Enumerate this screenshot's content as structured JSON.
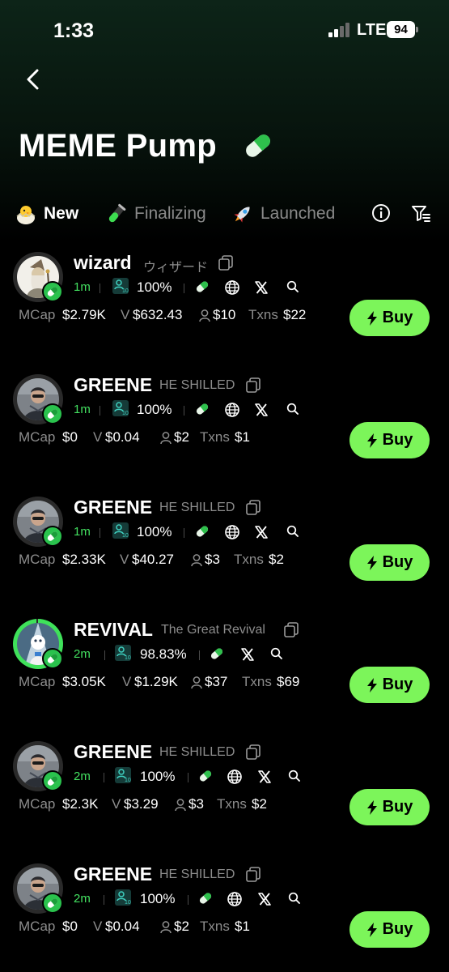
{
  "status_bar": {
    "time": "1:33",
    "network": "LTE",
    "battery": "94"
  },
  "header": {
    "title": "MEME Pump",
    "title_icon": "pill-icon",
    "back_icon": "chevron-left-icon"
  },
  "tabs": [
    {
      "label": "New",
      "icon": "chick-icon",
      "active": true
    },
    {
      "label": "Finalizing",
      "icon": "test-tube-icon",
      "active": false
    },
    {
      "label": "Launched",
      "icon": "rocket-icon",
      "active": false
    }
  ],
  "toolbar": {
    "info_icon": "info-icon",
    "filter_icon": "filter-icon"
  },
  "labels": {
    "mcap": "MCap",
    "volume": "V",
    "txns": "Txns",
    "buy": "Buy"
  },
  "colors": {
    "accent": "#7cf55a",
    "age": "#43e060",
    "holder_icon": "#3fd0c0",
    "muted": "#8d8d8d"
  },
  "tokens": [
    {
      "name": "wizard",
      "subtitle": "ウィザード",
      "avatar": "wizard-avatar",
      "age": "1m",
      "holders_pct": "100%",
      "links": [
        "pill",
        "globe",
        "x",
        "search"
      ],
      "mcap": "$2.79K",
      "volume": "$632.43",
      "holders": "$10",
      "txns": "$22"
    },
    {
      "name": "GREENE",
      "subtitle": "HE SHILLED",
      "avatar": "greene-avatar",
      "age": "1m",
      "holders_pct": "100%",
      "links": [
        "pill",
        "globe",
        "x",
        "search"
      ],
      "mcap": "$0",
      "volume": "$0.04",
      "holders": "$2",
      "txns": "$1"
    },
    {
      "name": "GREENE",
      "subtitle": "HE SHILLED",
      "avatar": "greene-avatar",
      "age": "1m",
      "holders_pct": "100%",
      "links": [
        "pill",
        "globe",
        "x",
        "search"
      ],
      "mcap": "$2.33K",
      "volume": "$40.27",
      "holders": "$3",
      "txns": "$2"
    },
    {
      "name": "REVIVAL",
      "subtitle": "The Great Revival",
      "avatar": "revival-avatar",
      "age": "2m",
      "holders_pct": "98.83%",
      "links": [
        "pill",
        "x",
        "search"
      ],
      "mcap": "$3.05K",
      "volume": "$1.29K",
      "holders": "$37",
      "txns": "$69"
    },
    {
      "name": "GREENE",
      "subtitle": "HE SHILLED",
      "avatar": "greene-avatar",
      "age": "2m",
      "holders_pct": "100%",
      "links": [
        "pill",
        "globe",
        "x",
        "search"
      ],
      "mcap": "$2.3K",
      "volume": "$3.29",
      "holders": "$3",
      "txns": "$2"
    },
    {
      "name": "GREENE",
      "subtitle": "HE SHILLED",
      "avatar": "greene-avatar",
      "age": "2m",
      "holders_pct": "100%",
      "links": [
        "pill",
        "globe",
        "x",
        "search"
      ],
      "mcap": "$0",
      "volume": "$0.04",
      "holders": "$2",
      "txns": "$1"
    }
  ]
}
